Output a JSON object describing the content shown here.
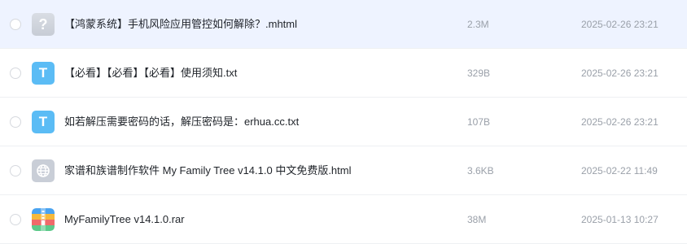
{
  "files": [
    {
      "name": "【鸿蒙系统】手机风险应用管控如何解除？.mhtml",
      "size": "2.3M",
      "date": "2025-02-26 23:21",
      "icon": "unknown-file-icon",
      "icon_glyph": "?",
      "selected": true
    },
    {
      "name": "【必看】【必看】【必看】使用须知.txt",
      "size": "329B",
      "date": "2025-02-26 23:21",
      "icon": "txt-file-icon",
      "icon_glyph": "T",
      "selected": false
    },
    {
      "name": "如若解压需要密码的话，解压密码是：erhua.cc.txt",
      "size": "107B",
      "date": "2025-02-26 23:21",
      "icon": "txt-file-icon",
      "icon_glyph": "T",
      "selected": false
    },
    {
      "name": "家谱和族谱制作软件 My Family Tree v14.1.0 中文免费版.html",
      "size": "3.6KB",
      "date": "2025-02-22 11:49",
      "icon": "html-globe-icon",
      "selected": false
    },
    {
      "name": "MyFamilyTree v14.1.0.rar",
      "size": "38M",
      "date": "2025-01-13 10:27",
      "icon": "rar-archive-icon",
      "selected": false
    }
  ],
  "colors": {
    "selected_row": "#eef3ff",
    "txt_icon": "#5bbcf5",
    "muted_text": "#9aa0a9"
  }
}
